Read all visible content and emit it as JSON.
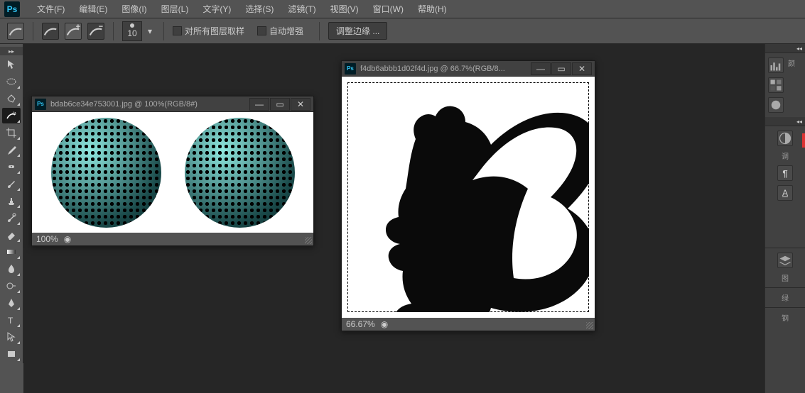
{
  "app": {
    "logo": "Ps"
  },
  "menu": {
    "file": "文件(F)",
    "edit": "编辑(E)",
    "image": "图像(I)",
    "layer": "图层(L)",
    "type": "文字(Y)",
    "select": "选择(S)",
    "filter": "滤镜(T)",
    "view": "视图(V)",
    "window": "窗口(W)",
    "help": "帮助(H)"
  },
  "options": {
    "brush_size": "10",
    "sample_all": "对所有图层取样",
    "auto_enhance": "自动增强",
    "refine_edge": "调整边缘 ..."
  },
  "documents": {
    "doc1": {
      "title": "bdab6ce34e753001.jpg @ 100%(RGB/8#)",
      "zoom": "100%"
    },
    "doc2": {
      "title": "f4db6abbb1d02f4d.jpg @ 66.7%(RGB/8...",
      "zoom": "66.67%"
    }
  },
  "panels": {
    "color_short": "颜",
    "adjust_short": "调",
    "layers_short": "图",
    "channels_short": "绿",
    "paths_short": "钢",
    "char_a": "A"
  }
}
